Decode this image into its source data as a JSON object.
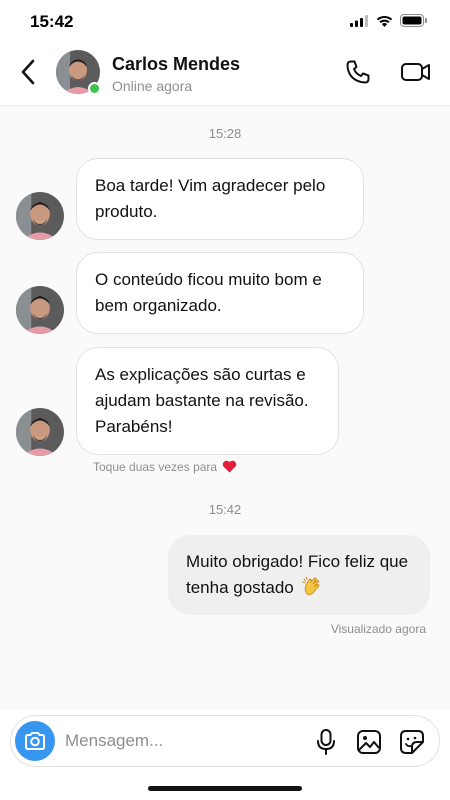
{
  "status_bar": {
    "time": "15:42",
    "icons": [
      "cellular-signal-icon",
      "wifi-icon",
      "battery-icon"
    ]
  },
  "header": {
    "contact_name": "Carlos Mendes",
    "contact_status": "Online agora",
    "icons": [
      "back-chevron-icon",
      "phone-icon",
      "video-camera-icon"
    ],
    "online_color": "#3fc24d"
  },
  "chat": {
    "time_separators": [
      "15:28",
      "15:42"
    ],
    "incoming": [
      {
        "lines": [
          "Boa tarde! Vim agradecer pelo",
          "produto."
        ]
      },
      {
        "lines": [
          "O conteúdo ficou muito bom e",
          "bem organizado."
        ]
      },
      {
        "lines": [
          "As explicações são curtas e",
          "ajudam bastante na revisão.",
          "Parabéns!"
        ]
      }
    ],
    "double_tap_hint": "Toque duas vezes para",
    "hint_emoji": "heart-icon",
    "outgoing": [
      {
        "lines": [
          "Muito obrigado! Fico feliz que",
          "tenha gostado"
        ],
        "emoji": "clapping-hands-icon"
      }
    ],
    "seen_text": "Visualizado agora"
  },
  "composer": {
    "placeholder": "Mensagem...",
    "icons": [
      "camera-icon",
      "microphone-icon",
      "gallery-icon",
      "sticker-icon"
    ],
    "accent_color": "#3797f0"
  }
}
